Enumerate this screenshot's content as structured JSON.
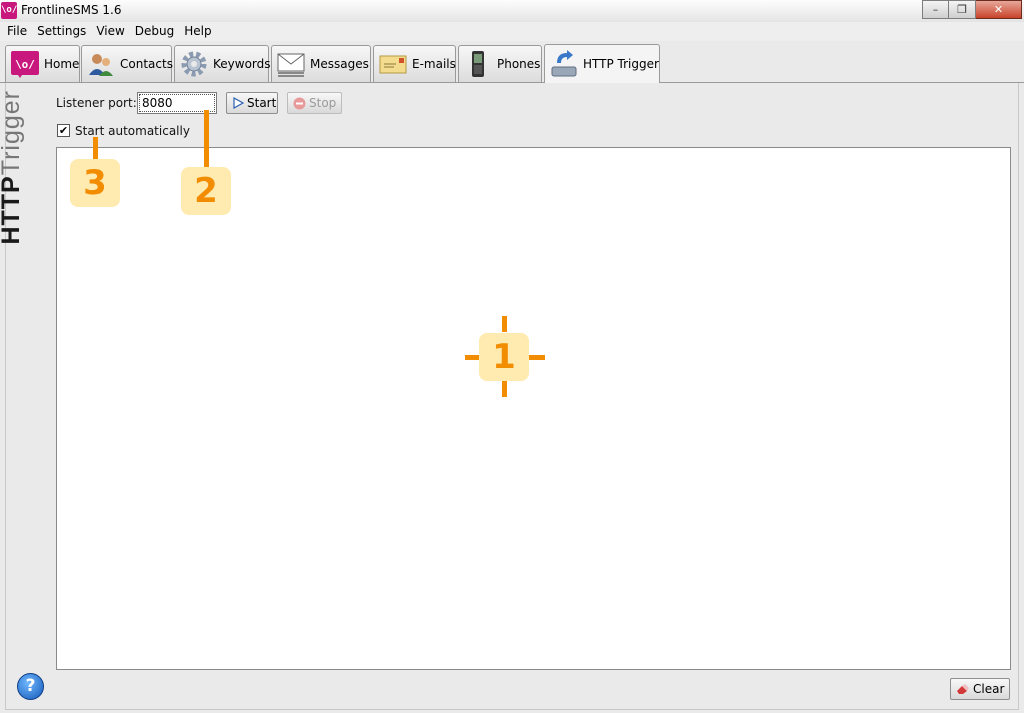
{
  "window": {
    "title": "FrontlineSMS 1.6",
    "app_icon_text": "\\o/",
    "minimize_glyph": "–",
    "maximize_glyph": "❐",
    "close_glyph": "✕"
  },
  "menu": [
    "File",
    "Settings",
    "View",
    "Debug",
    "Help"
  ],
  "tabs": [
    {
      "label": "Home",
      "icon": "frontline-logo-icon"
    },
    {
      "label": "Contacts",
      "icon": "contacts-icon"
    },
    {
      "label": "Keywords",
      "icon": "gear-icon"
    },
    {
      "label": "Messages",
      "icon": "envelope-stack-icon"
    },
    {
      "label": "E-mails",
      "icon": "email-icon"
    },
    {
      "label": "Phones",
      "icon": "phone-icon"
    },
    {
      "label": "HTTP Trigger",
      "icon": "http-trigger-icon",
      "active": true
    }
  ],
  "panel": {
    "vertical_title_bold": "HTTP",
    "vertical_title_light": "Trigger",
    "listener_port_label": "Listener port:",
    "listener_port_value": "8080",
    "start_label": "Start",
    "stop_label": "Stop",
    "start_auto_label": "Start automatically",
    "start_auto_checked": true,
    "check_glyph": "✔",
    "clear_label": "Clear",
    "help_glyph": "?"
  },
  "callouts": [
    "1",
    "2",
    "3"
  ],
  "colors": {
    "accent": "#c8187e",
    "callout_orange": "#f28c00",
    "callout_fill": "#ffeab0"
  }
}
